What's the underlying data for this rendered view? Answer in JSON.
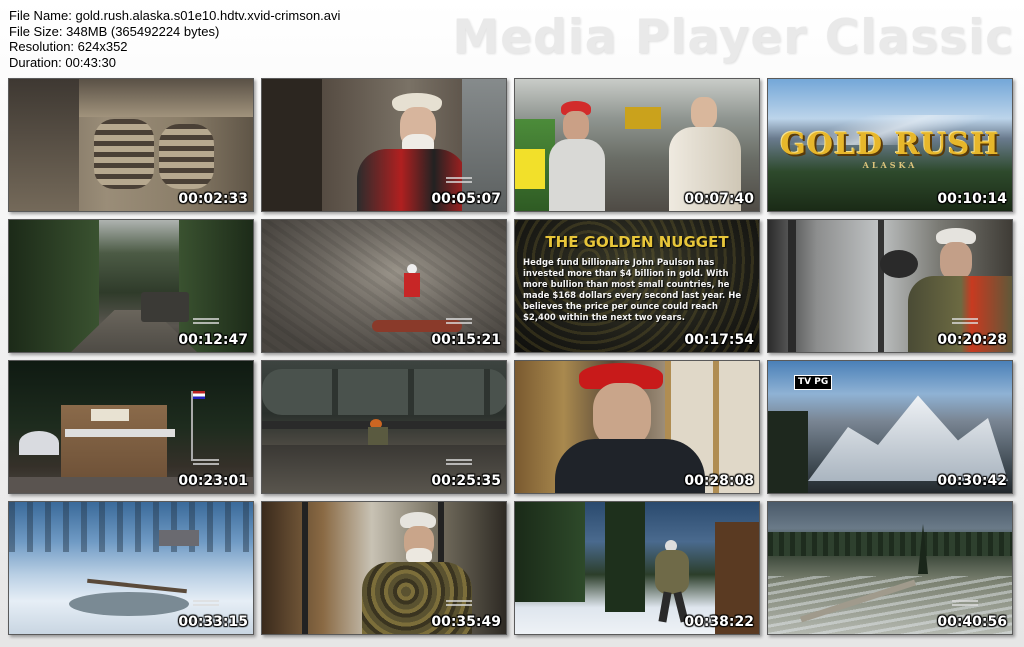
{
  "header": {
    "file_name": "File Name: gold.rush.alaska.s01e10.hdtv.xvid-crimson.avi",
    "file_size": "File Size: 348MB (365492224 bytes)",
    "resolution": "Resolution: 624x352",
    "duration": "Duration: 00:43:30"
  },
  "brand": "Media Player Classic",
  "thumbnails": [
    {
      "time": "00:02:33"
    },
    {
      "time": "00:05:07"
    },
    {
      "time": "00:07:40"
    },
    {
      "time": "00:10:14",
      "logo": "GOLD RUSH",
      "logo_sub": "ALASKA"
    },
    {
      "time": "00:12:47"
    },
    {
      "time": "00:15:21"
    },
    {
      "time": "00:17:54",
      "overlay_title": "THE GOLDEN NUGGET",
      "overlay_body": "Hedge fund billionaire John Paulson has invested more than $4 billion in gold. With more bullion than most small countries, he made $168 dollars every second last year. He believes the price per ounce could reach $2,400 within the next two years."
    },
    {
      "time": "00:20:28"
    },
    {
      "time": "00:23:01"
    },
    {
      "time": "00:25:35"
    },
    {
      "time": "00:28:08"
    },
    {
      "time": "00:30:42",
      "rating": "TV PG"
    },
    {
      "time": "00:33:15"
    },
    {
      "time": "00:35:49"
    },
    {
      "time": "00:38:22"
    },
    {
      "time": "00:40:56"
    }
  ]
}
